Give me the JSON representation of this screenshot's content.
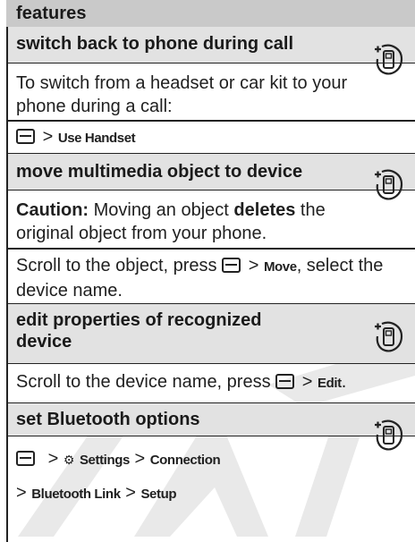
{
  "header": {
    "title": "features"
  },
  "sections": [
    {
      "title": "switch back to phone during call",
      "body": "To switch from a headset or car kit to your phone during a call:",
      "path": {
        "gt": ">",
        "item": "Use Handset"
      }
    },
    {
      "title": "move multimedia object to device",
      "caution_label": "Caution:",
      "caution_pre": " Moving an object ",
      "caution_bold": "deletes",
      "caution_post": " the original object from your phone.",
      "step_pre": "Scroll to the object, press",
      "step_gt": ">",
      "step_item": "Move",
      "step_post": ", select the device name."
    },
    {
      "title": "edit properties of recognized device",
      "step_pre": "Scroll to the device name, press",
      "step_gt": ">",
      "step_item": "Edit",
      "step_post": "."
    },
    {
      "title": "set Bluetooth options",
      "path_gt1": ">",
      "path_item1": "Settings",
      "path_gt2": ">",
      "path_item2": "Connection",
      "path_gt3": ">",
      "path_item3": "Bluetooth Link",
      "path_gt4": ">",
      "path_item4": "Setup"
    }
  ],
  "icons": {
    "phone_feature": "phone-feature-icon",
    "menu_key": "menu-key-icon",
    "settings": "settings-icon"
  },
  "colors": {
    "header_bg": "#c9c9c9",
    "section_bg": "#e2e2e2",
    "watermark": "#e6e6e6"
  }
}
